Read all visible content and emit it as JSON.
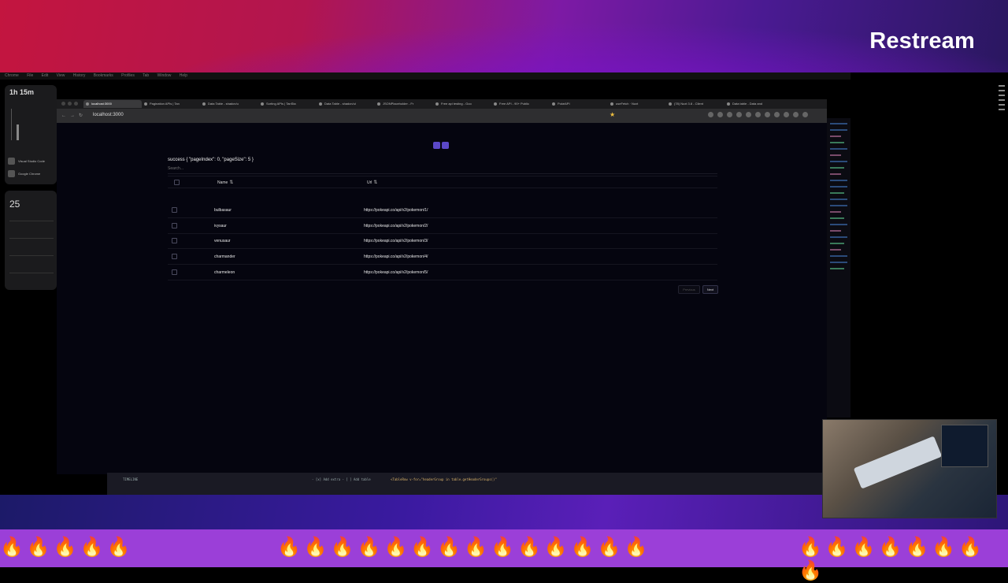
{
  "overlay": {
    "brand": "Restream",
    "fire_left": "🔥🔥🔥🔥🔥",
    "fire_mid": "🔥🔥🔥🔥🔥🔥🔥🔥🔥🔥🔥🔥🔥🔥",
    "fire_right": "🔥🔥🔥🔥🔥🔥🔥🔥"
  },
  "desktop": {
    "menubar": [
      "Chrome",
      "File",
      "Edit",
      "View",
      "History",
      "Bookmarks",
      "Profiles",
      "Tab",
      "Window",
      "Help"
    ],
    "screen_time": "1h 15m",
    "apps": [
      "Visual Studio Code",
      "Google Chrome"
    ],
    "calendar_day": "25"
  },
  "browser": {
    "tabs": [
      {
        "label": "localhost:3000",
        "active": true
      },
      {
        "label": "Pagination APIs | Tan",
        "active": false
      },
      {
        "label": "Data Table - shadcn/u",
        "active": false
      },
      {
        "label": "Sorting APIs | TanSta",
        "active": false
      },
      {
        "label": "Data Table - shadcn/ui",
        "active": false
      },
      {
        "label": "JSONPlaceholder - Fr",
        "active": false
      },
      {
        "label": "Free api testing - Goo",
        "active": false
      },
      {
        "label": "Free API - 90+ Public",
        "active": false
      },
      {
        "label": "PokéAPI",
        "active": false
      },
      {
        "label": "useFetch · Nuxt",
        "active": false
      },
      {
        "label": "(78) Nuxt 3.8 - Client",
        "active": false
      },
      {
        "label": "Data table - Data and",
        "active": false
      }
    ],
    "url": "localhost:3000"
  },
  "page": {
    "success_text": "success { \"pageIndex\": 0, \"pageSize\": 5 }",
    "search_placeholder": "Search...",
    "columns": {
      "name": "Name",
      "url": "Url"
    },
    "rows": [
      {
        "name": "bulbasaur",
        "url": "https://pokeapi.co/api/v2/pokemon/1/"
      },
      {
        "name": "ivysaur",
        "url": "https://pokeapi.co/api/v2/pokemon/2/"
      },
      {
        "name": "venusaur",
        "url": "https://pokeapi.co/api/v2/pokemon/3/"
      },
      {
        "name": "charmander",
        "url": "https://pokeapi.co/api/v2/pokemon/4/"
      },
      {
        "name": "charmeleon",
        "url": "https://pokeapi.co/api/v2/pokemon/5/"
      }
    ],
    "pagination": {
      "previous": "Previous",
      "next": "Next"
    }
  },
  "editor": {
    "line1": "TIMELINE",
    "line2": "- [x] Add extra   - [ ] Add table",
    "line3": "<TableRow v-for=\"headerGroup in table.getHeaderGroups()\""
  }
}
